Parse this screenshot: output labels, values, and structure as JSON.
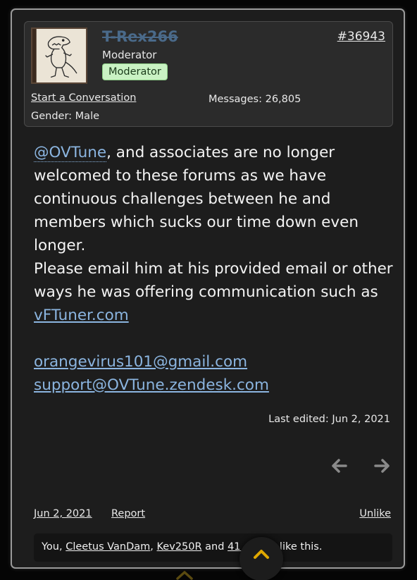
{
  "user": {
    "name": "T-Rex266",
    "title": "Moderator",
    "badge": "Moderator",
    "start_conversation": "Start a Conversation",
    "messages_label": "Messages:",
    "messages_count": "26,805",
    "gender": "Gender: Male"
  },
  "post": {
    "number": "#36943",
    "mention": "@OVTune",
    "line1_rest": ", and associates are no longer welcomed to these forums as we have continuous challenges between he and members which sucks our time down even longer.",
    "line2": "Please email him at his provided email or other ways he was offering communication such as ",
    "link_vftuner": "vFTuner.com",
    "email1": "orangevirus101@gmail.com",
    "email2": "support@OVTune.zendesk.com",
    "last_edited": "Last edited: Jun 2, 2021"
  },
  "footer": {
    "date": "Jun 2, 2021",
    "report": "Report",
    "unlike": "Unlike"
  },
  "likes": {
    "you": "You,",
    "user1": "Cleetus VanDam",
    "comma": ",",
    "user2": "Kev250R",
    "and": "and",
    "others": "41 others",
    "suffix": "like this."
  },
  "icons": {
    "prev": "arrow-left-icon",
    "next": "arrow-right-icon",
    "scroll": "chevron-up-icon"
  },
  "colors": {
    "link": "#8bb5e0",
    "badge_bg": "#c9f2c3",
    "scroll_chevron": "#e0a800"
  }
}
